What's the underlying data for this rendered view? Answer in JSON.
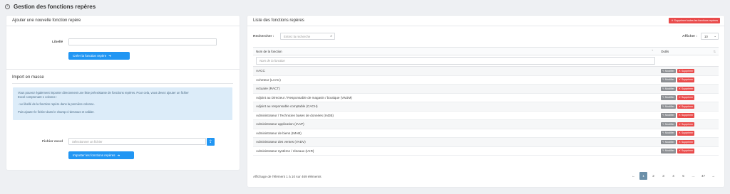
{
  "header": {
    "back_icon": "chevron-left-icon",
    "title": "Gestion des fonctions repères"
  },
  "left": {
    "card_title": "Ajouter une nouvelle fonction repère",
    "libelle_label": "Libellé",
    "libelle_value": "",
    "create_button": "Créer la fonction repère",
    "import_title": "Import en masse",
    "info_lines": [
      "Vous pouvez également importer directement une liste préexistante de fonctions repères. Pour cela, vous devez ajouter un fichier",
      "Excel comprenant 1 colonne :",
      "- Le libellé de la fonction repère dans la première colonne.",
      "Puis ajouter le fichier dans le champ ci-dessous et valider."
    ],
    "file_label": "Fichier excel",
    "file_placeholder": "Sélectionner un fichier",
    "import_button": "Importer les fonctions repères"
  },
  "right": {
    "card_title": "Liste des fonctions repères",
    "delete_all_button": "Supprimer toutes les fonctions repères",
    "search_label": "Rechercher :",
    "search_placeholder": "Entrez la recherche",
    "show_label": "Afficher :",
    "show_value": "10",
    "col_name": "Nom de la fonction",
    "col_tools": "Outils",
    "filter_placeholder": "Nom de la fonction",
    "modify_label": "Modifier",
    "delete_label": "Supprimer",
    "rows": [
      "AACC",
      "Acheteur (LAAC)",
      "Actuaire (RACT)",
      "Adjoint au Directeur / Responsable de magasin / boutique (VMJM)",
      "Adjoint au responsable comptable (CACH)",
      "Administrateur / Technicien bases de données (IADB)",
      "Administrateur application (IAAP)",
      "Administrateur de biens (IMAB)",
      "Administrateur des ventes (VADV)",
      "Administrateur système / réseaux (IAIR)"
    ],
    "footer_info": "Affichage de l'élément 1 à 10 sur 469 éléments",
    "pagination": [
      "←",
      "1",
      "2",
      "3",
      "4",
      "5",
      "…",
      "47",
      "→"
    ],
    "active_page": "1"
  },
  "colors": {
    "primary": "#2196f3",
    "danger": "#e94b4b",
    "info_bg": "#dcecf9",
    "page_active": "#6b8fa8"
  }
}
